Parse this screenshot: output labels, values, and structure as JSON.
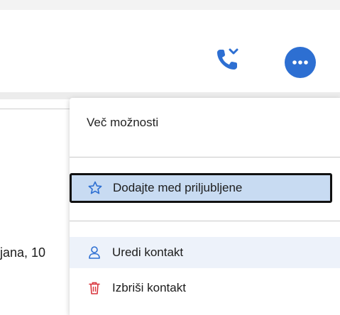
{
  "header": {
    "actions": {
      "call_icon": "phone-dropdown-icon",
      "more_icon": "more-options-icon"
    }
  },
  "background": {
    "partial_text": "jana, 10"
  },
  "menu": {
    "title": "Več možnosti",
    "items": [
      {
        "label": "Dodajte med priljubljene",
        "icon": "star-icon",
        "focused": true
      },
      {
        "label": "Uredi kontakt",
        "icon": "person-icon",
        "hovered": true
      },
      {
        "label": "Izbriši kontakt",
        "icon": "trash-icon"
      }
    ]
  },
  "colors": {
    "accent": "#2d6fd2",
    "focus_bg": "#c8dbf2",
    "hover_bg": "#edf2fa",
    "delete_icon": "#d9363e"
  }
}
